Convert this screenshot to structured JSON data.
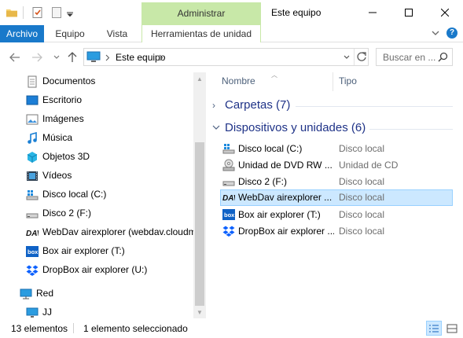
{
  "window": {
    "manage_tab": "Administrar",
    "title": "Este equipo"
  },
  "ribbon": {
    "tabs": [
      "Archivo",
      "Equipo",
      "Vista",
      "Herramientas de unidad"
    ]
  },
  "address": {
    "path": "Este equipo",
    "search_placeholder": "Buscar en ..."
  },
  "nav": {
    "items": [
      "Documentos",
      "Escritorio",
      "Imágenes",
      "Música",
      "Objetos 3D",
      "Vídeos",
      "Disco local (C:)",
      "Disco 2 (F:)",
      "WebDav airexplorer (webdav.cloudm",
      "Box air explorer (T:)",
      "DropBox air explorer (U:)",
      "Red",
      "JJ"
    ]
  },
  "content": {
    "columns": {
      "name": "Nombre",
      "type": "Tipo"
    },
    "groups": [
      {
        "title": "Carpetas (7)",
        "expanded": false
      },
      {
        "title": "Dispositivos y unidades (6)",
        "expanded": true
      }
    ],
    "rows": [
      {
        "name": "Disco local (C:)",
        "type": "Disco local",
        "icon": "windows-drive-icon"
      },
      {
        "name": "Unidad de DVD RW ...",
        "type": "Unidad de CD",
        "icon": "dvd-drive-icon"
      },
      {
        "name": "Disco 2 (F:)",
        "type": "Disco local",
        "icon": "drive-icon"
      },
      {
        "name": "WebDav airexplorer ...",
        "type": "Disco local",
        "icon": "webdav-icon",
        "selected": true
      },
      {
        "name": "Box air explorer (T:)",
        "type": "Disco local",
        "icon": "box-icon"
      },
      {
        "name": "DropBox air explorer ...",
        "type": "Disco local",
        "icon": "dropbox-icon"
      }
    ]
  },
  "status": {
    "count": "13 elementos",
    "selection": "1 elemento seleccionado"
  },
  "colors": {
    "accent": "#1979ca",
    "manage": "#c8e8a8",
    "selection": "#cce8ff",
    "group_title": "#1e3287"
  }
}
